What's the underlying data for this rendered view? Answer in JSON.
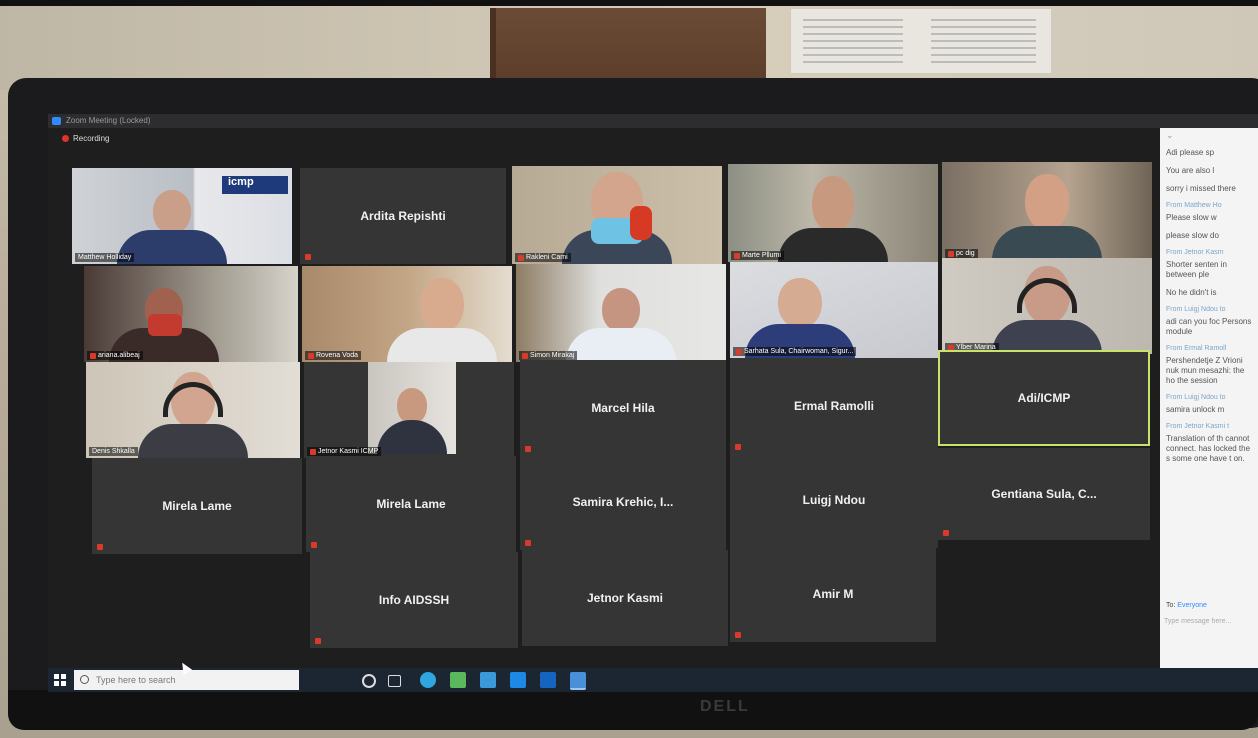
{
  "window": {
    "title": "Zoom Meeting (Locked)",
    "recording_label": "Recording"
  },
  "participants": [
    {
      "name": "Matthew Holliday",
      "video": true
    },
    {
      "name": "Ardita Repishti",
      "video": false
    },
    {
      "name": "Rakleni Cami",
      "video": true
    },
    {
      "name": "Marte Pllumi",
      "video": true
    },
    {
      "name": "pc dig",
      "video": true
    },
    {
      "name": "ariana.alibeaj",
      "video": true
    },
    {
      "name": "Rovena Voda",
      "video": true
    },
    {
      "name": "Simon Mirakaj",
      "video": true
    },
    {
      "name": "Sarhata Sula, Chairwoman, Sigur...",
      "video": true
    },
    {
      "name": "Ylber Marina",
      "video": true
    },
    {
      "name": "Denis Shkalla",
      "video": true
    },
    {
      "name": "Jetnor Kasmi ICMP",
      "video": true
    },
    {
      "name": "Marcel Hila",
      "video": false
    },
    {
      "name": "Ermal Ramolli",
      "video": false
    },
    {
      "name": "Adi/ICMP",
      "video": false,
      "active_speaker": true
    },
    {
      "name": "Mirela Lame",
      "video": false
    },
    {
      "name": "Mirela Lame",
      "video": false
    },
    {
      "name": "Samira Krehic, I...",
      "video": false
    },
    {
      "name": "Luigj Ndou",
      "video": false
    },
    {
      "name": "Gentiana Sula, C...",
      "video": false
    },
    {
      "name": "Info AIDSSH",
      "video": false
    },
    {
      "name": "Jetnor Kasmi",
      "video": false
    },
    {
      "name": "Amir M",
      "video": false
    }
  ],
  "chat": {
    "messages": [
      {
        "from": "",
        "text": "Adi please sp"
      },
      {
        "from": "",
        "text": "You are also l"
      },
      {
        "from": "",
        "text": "sorry i missed there"
      },
      {
        "from": "From Matthew Ho",
        "text": "Please slow w"
      },
      {
        "from": "",
        "text": "please slow do"
      },
      {
        "from": "From Jetnor Kasm",
        "text": "Shorter senten in between ple"
      },
      {
        "from": "",
        "text": "No he didn't is"
      },
      {
        "from": "From Luigj Ndou to",
        "text": "adi can you foc Persons module"
      },
      {
        "from": "From Ermal Ramoll",
        "text": "Pershendetje Z Vrioni nuk mun mesazhi: the ho the session"
      },
      {
        "from": "From Luigj Ndou to",
        "text": "samira unlock m"
      },
      {
        "from": "From Jetnor Kasmi t",
        "text": "Translation of th cannot connect. has locked the s some one have t on."
      }
    ],
    "to_label": "To:",
    "to_value": "Everyone",
    "input_placeholder": "Type message here..."
  },
  "taskbar": {
    "search_placeholder": "Type here to search"
  },
  "monitor_brand": "DELL"
}
